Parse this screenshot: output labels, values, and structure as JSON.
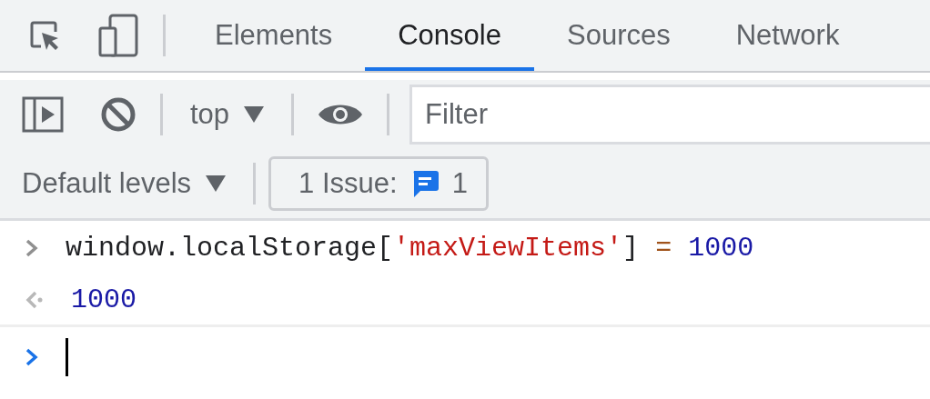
{
  "tabs": [
    {
      "label": "Elements",
      "selected": false
    },
    {
      "label": "Console",
      "selected": true
    },
    {
      "label": "Sources",
      "selected": false
    },
    {
      "label": "Network",
      "selected": false
    }
  ],
  "console_toolbar": {
    "context": "top",
    "filter": {
      "placeholder": "Filter"
    },
    "levels": "Default levels",
    "issues": {
      "label": "1 Issue:",
      "count": "1"
    }
  },
  "console": [
    {
      "kind": "input",
      "tokens": [
        {
          "kind": "plain",
          "text": "window.localStorage["
        },
        {
          "kind": "string",
          "text": "'maxViewItems'"
        },
        {
          "kind": "plain",
          "text": "] "
        },
        {
          "kind": "operator",
          "text": "= "
        },
        {
          "kind": "number",
          "text": "1000"
        }
      ]
    },
    {
      "kind": "result",
      "tokens": [
        {
          "kind": "number",
          "text": "1000"
        }
      ]
    }
  ]
}
